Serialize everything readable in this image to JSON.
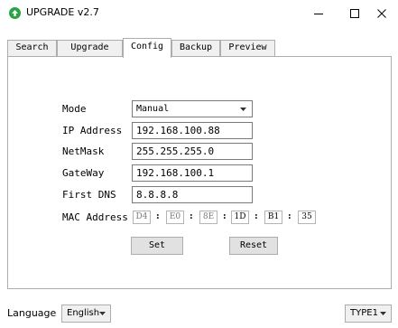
{
  "window": {
    "title": "UPGRADE v2.7"
  },
  "tabs": [
    "Search",
    "Upgrade",
    "Config",
    "Backup",
    "Preview"
  ],
  "active_tab": "Config",
  "form": {
    "mode_label": "Mode",
    "mode_value": "Manual",
    "ip_label": "IP Address",
    "ip_value": "192.168.100.88",
    "netmask_label": "NetMask",
    "netmask_value": "255.255.255.0",
    "gateway_label": "GateWay",
    "gateway_value": "192.168.100.1",
    "dns_label": "First DNS",
    "dns_value": "8.8.8.8",
    "mac_label": "MAC Address",
    "mac_octets": [
      "D4",
      "E0",
      "8E",
      "1D",
      "B1",
      "35"
    ],
    "mac_separator": ":"
  },
  "buttons": {
    "set": "Set",
    "reset": "Reset"
  },
  "footer": {
    "language_label": "Language",
    "language_value": "English",
    "type_value": "TYPE1"
  },
  "colors": {
    "app_icon": "#2aa345",
    "border": "#adadad",
    "button_bg": "#e1e1e1"
  },
  "icons": {
    "app": "green-circle-up-arrow-icon",
    "minimize": "minimize-icon",
    "maximize": "maximize-icon",
    "close": "close-icon",
    "dropdown": "chevron-down-icon"
  }
}
